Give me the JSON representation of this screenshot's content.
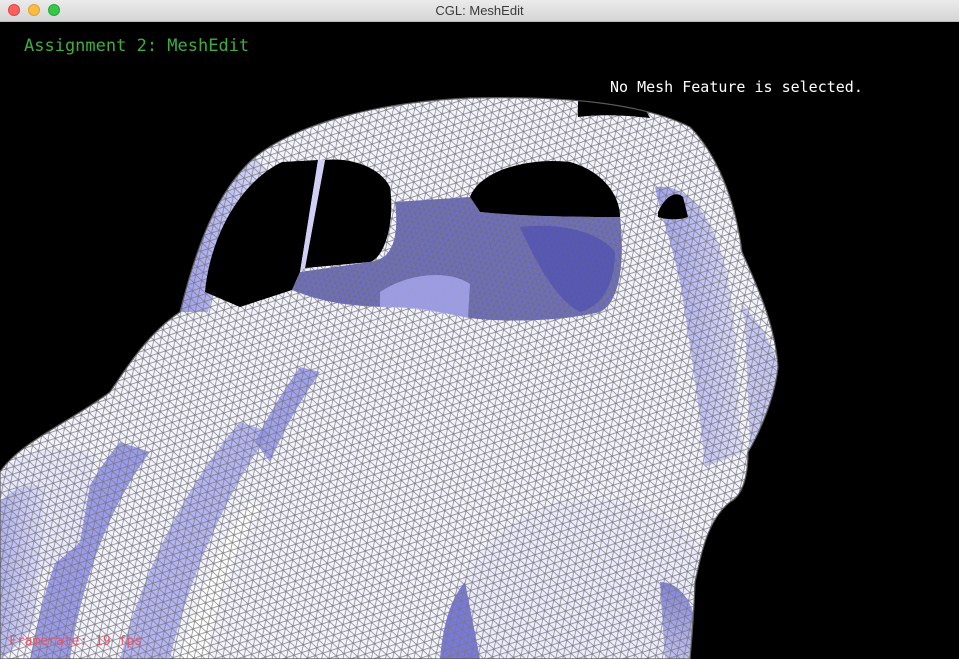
{
  "window": {
    "title": "CGL: MeshEdit"
  },
  "overlay": {
    "app_title": "Assignment 2: MeshEdit",
    "selection_status": "No Mesh Feature is selected.",
    "framerate": "Framerate: 19 fps"
  },
  "colors": {
    "background": "#000000",
    "mesh_fill": "#f4f4ff",
    "mesh_shade": "#8c8cf0",
    "mesh_wire": "#7a7a7a",
    "title_text": "#3fae3f",
    "status_text": "#ffffff",
    "framerate_text": "#e0566a"
  },
  "icons": {
    "close": "close-button",
    "minimize": "minimize-button",
    "maximize": "maximize-button"
  }
}
